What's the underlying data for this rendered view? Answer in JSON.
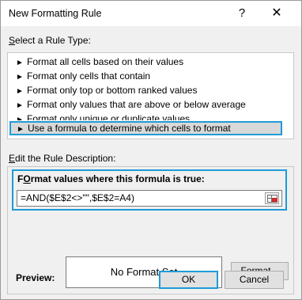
{
  "window": {
    "title": "New Formatting Rule",
    "help_glyph": "?",
    "close_glyph": "✕"
  },
  "rule_type": {
    "label_prefix": "",
    "label_accel": "S",
    "label_rest": "elect a Rule Type:",
    "items": [
      {
        "text": "Format all cells based on their values"
      },
      {
        "text": "Format only cells that contain"
      },
      {
        "text": "Format only top or bottom ranked values"
      },
      {
        "text": "Format only values that are above or below average"
      },
      {
        "text": "Format only unique or duplicate values"
      },
      {
        "text": "Use a formula to determine which cells to format",
        "selected": true
      }
    ],
    "arrow_glyph": "►"
  },
  "description": {
    "label_prefix": "",
    "label_accel": "E",
    "label_rest": "dit the Rule Description:",
    "formula_heading_accel": "O",
    "formula_heading_pre": "F",
    "formula_heading_rest": "rmat values where this formula is true:",
    "formula_value": "=AND($E$2<>\"\",$E$2=A4)"
  },
  "preview": {
    "label": "Preview:",
    "sample_text": "No Format Set",
    "format_button_accel": "F",
    "format_button_rest": "ormat..."
  },
  "buttons": {
    "ok": "OK",
    "cancel": "Cancel"
  },
  "colors": {
    "highlight": "#1e9bd7",
    "dialog_bg": "#f0f0f0",
    "selected_bg": "#d9d9d9"
  }
}
